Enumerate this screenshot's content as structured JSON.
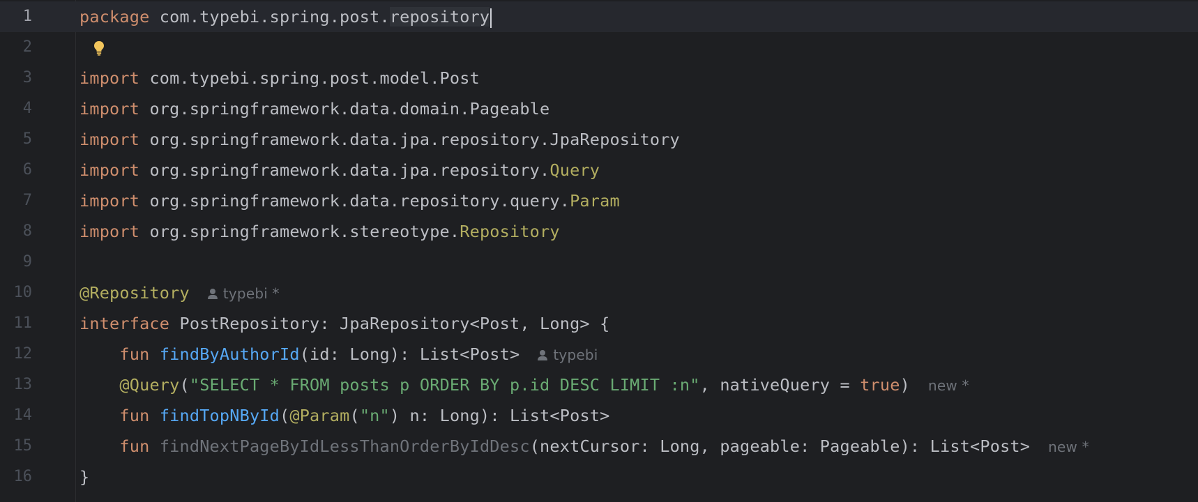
{
  "editor": {
    "lines": [
      {
        "number": "1",
        "kw": "package",
        "rest_a": " com.typebi.spring.post.",
        "rest_b": "repository"
      },
      {
        "number": "2"
      },
      {
        "number": "3",
        "kw": "import",
        "rest": " com.typebi.spring.post.model.Post"
      },
      {
        "number": "4",
        "kw": "import",
        "rest": " org.springframework.data.domain.Pageable"
      },
      {
        "number": "5",
        "kw": "import",
        "rest": " org.springframework.data.jpa.repository.JpaRepository"
      },
      {
        "number": "6",
        "kw": "import",
        "rest": " org.springframework.data.jpa.repository.",
        "ann": "Query"
      },
      {
        "number": "7",
        "kw": "import",
        "rest": " org.springframework.data.repository.query.",
        "ann": "Param"
      },
      {
        "number": "8",
        "kw": "import",
        "rest": " org.springframework.stereotype.",
        "ann": "Repository"
      },
      {
        "number": "9"
      },
      {
        "number": "10",
        "ann": "@Repository",
        "hint_author": "typebi *"
      },
      {
        "number": "11",
        "kw": "interface",
        "rest": " PostRepository: JpaRepository<Post, Long> {"
      },
      {
        "number": "12",
        "indent": "    ",
        "kw": "fun",
        "fn": "findByAuthorId",
        "rest": "(id: Long): List<Post>",
        "hint_author": "typebi"
      },
      {
        "number": "13",
        "indent": "    ",
        "ann": "@Query",
        "p1": "(",
        "str": "\"SELECT * FROM posts p ORDER BY p.id DESC LIMIT :n\"",
        "p2": ", nativeQuery = ",
        "kw2": "true",
        "p3": ")",
        "hint": "new *"
      },
      {
        "number": "14",
        "indent": "    ",
        "kw": "fun",
        "fn": "findTopNById",
        "p1": "(",
        "ann": "@Param",
        "p2": "(",
        "str": "\"n\"",
        "p3": ") n: Long): List<Post>"
      },
      {
        "number": "15",
        "indent": "    ",
        "kw": "fun",
        "unused": "findNextPageByIdLessThanOrderByIdDesc",
        "rest": "(nextCursor: Long, pageable: Pageable): List<Post>",
        "hint": "new *"
      },
      {
        "number": "16",
        "rest": "}"
      }
    ]
  },
  "colors": {
    "background": "#1e1f22",
    "keyword": "#cf8e6d",
    "annotation": "#b3ae60",
    "function": "#56a8f5",
    "string": "#6aab73",
    "text": "#bcbec4",
    "hint": "#6f737a"
  },
  "icons": {
    "intention": "lightbulb-icon",
    "author": "person-icon"
  }
}
